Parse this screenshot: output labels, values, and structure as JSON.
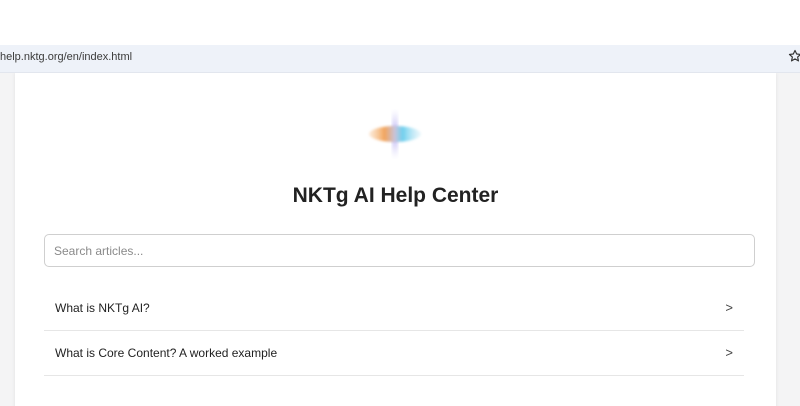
{
  "browser": {
    "url": "help.nktg.org/en/index.html",
    "bookmark_icon": "star-icon"
  },
  "page": {
    "title": "NKTg AI Help Center",
    "logo_icon": "gradient-lens-logo",
    "search": {
      "placeholder": "Search articles...",
      "value": ""
    },
    "articles": [
      {
        "title": "What is NKTg AI?",
        "arrow": ">"
      },
      {
        "title": "What is Core Content? A worked example",
        "arrow": ">"
      }
    ]
  }
}
